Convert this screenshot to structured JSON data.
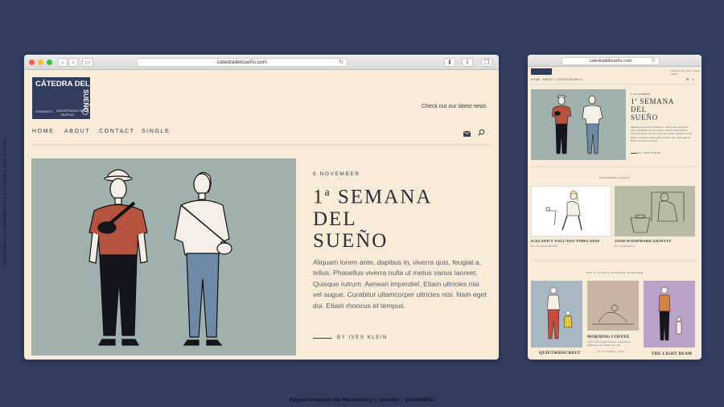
{
  "side_caption": "IDENTIDAD CORPORATIVA CÁTEDRA DEL SUEÑO",
  "footer_caption": "Departamento de Marketing y diseño / GOMARCO",
  "colors": {
    "background": "#2f3c5e",
    "page": "#f8ebd8",
    "logo": "#2f3c5e",
    "hero": "#9fb0ad",
    "shirt": "#b5533e"
  },
  "desktop": {
    "url": "catedradelsueño.com",
    "logo": {
      "title": "CÁTEDRA DEL",
      "vertical": "SUEÑO",
      "left_small": "GOMARCO",
      "right_small_1": "UNIVERSIDAD DE",
      "right_small_2": "MURCIA"
    },
    "tagline": "Check out our latest news",
    "nav": [
      "HOME",
      "ABOUT",
      "CONTACT",
      "SINGLE"
    ],
    "icons": {
      "mail": "envelope-icon",
      "search": "search-icon"
    },
    "post": {
      "date": "6 NOVEMBER",
      "title_num": "1",
      "title_sup": "a",
      "title_rest_1": "SEMANA",
      "title_line_2": "DEL",
      "title_line_3": "SUEÑO",
      "body": "Aliquam lorem ante, dapibus in, viverra quis, feugiat a, tellus. Phasellus viverra nulla ut metus varius laoreet. Quisque rutrum. Aenean imperdiet. Etiam ultricies nisi vel augue. Curabitur ullamcorper ultricies nisi. Nam eget dui. Etiam rhoncus et tempus.",
      "byline": "BY IVES KLEIN"
    }
  },
  "mobile": {
    "url": "catedradelsueño.com",
    "tagline": "Check out our latest news",
    "nav": [
      "HOME",
      "ABOUT",
      "CONTACT",
      "SINGLE"
    ],
    "post": {
      "date": "6 NOVEMBER",
      "title_num": "1",
      "title_sup": "a",
      "title_rest_1": "SEMANA",
      "title_line_2": "DEL",
      "title_line_3": "SUEÑO",
      "body": "Aliquam lorem ante, dapibus in, viverra quis, feugiat a, tellus. Phasellus viverra nulla ut metus varius laoreet. Quisque rutrum. Aenean imperdiet. Etiam ultricies nisi vel augue. Curabitur ullamcorper ultricies nisi. Nam eget dui. Etiam rhoncus et tempus.",
      "byline": "BY IVES KLEIN"
    },
    "featured_label": "FEATURED POSTS",
    "featured": [
      {
        "title": "ICELAND'S VOLCANO TIMELAPSE",
        "meta": "BY JO WASHBURN"
      },
      {
        "title": "JOSH WOODWARD GRAVITY",
        "meta": "BY GOMARCO"
      }
    ],
    "latest_label": "JOE'S LATEST STORIES FURTHER",
    "latest": [
      {
        "title": "QUIET&DISCREET",
        "meta": "",
        "text": ""
      },
      {
        "title": "MORNING COFFEE",
        "meta": "25 OCTOBER, 2016",
        "text": "Lorem ipsum dolor sit amet, consectetur adipiscing elit. Integer nec odio."
      },
      {
        "title": "THE LIGHT BEAM",
        "meta": "",
        "text": ""
      }
    ]
  }
}
